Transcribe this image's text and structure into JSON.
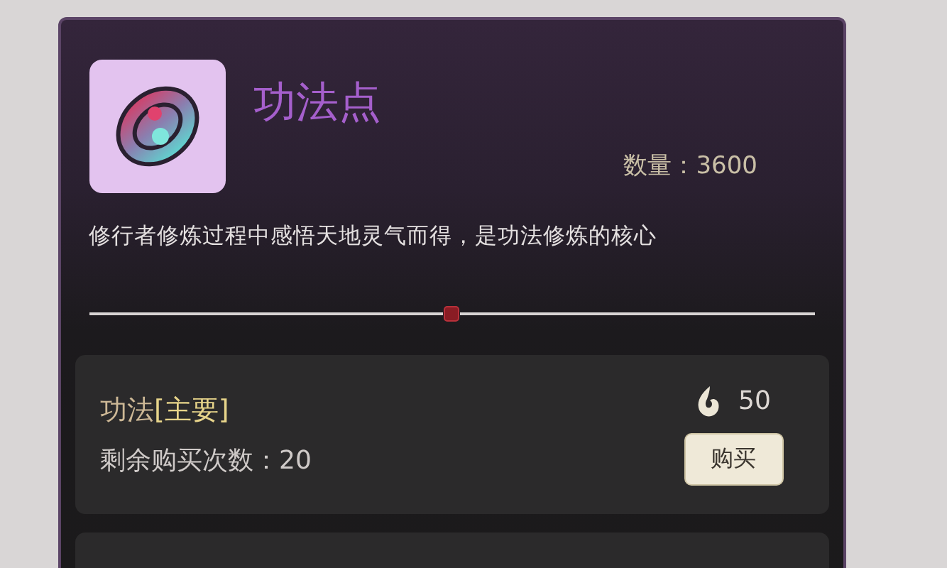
{
  "item": {
    "title": "功法点",
    "quantity_label": "数量：",
    "quantity": "3600",
    "description": "修行者修炼过程中感悟天地灵气而得，是功法修炼的核心"
  },
  "offers": [
    {
      "name": "功法",
      "tag": "[主要]",
      "remaining": "剩余购买次数：20",
      "price": "50",
      "button": "购买"
    }
  ]
}
